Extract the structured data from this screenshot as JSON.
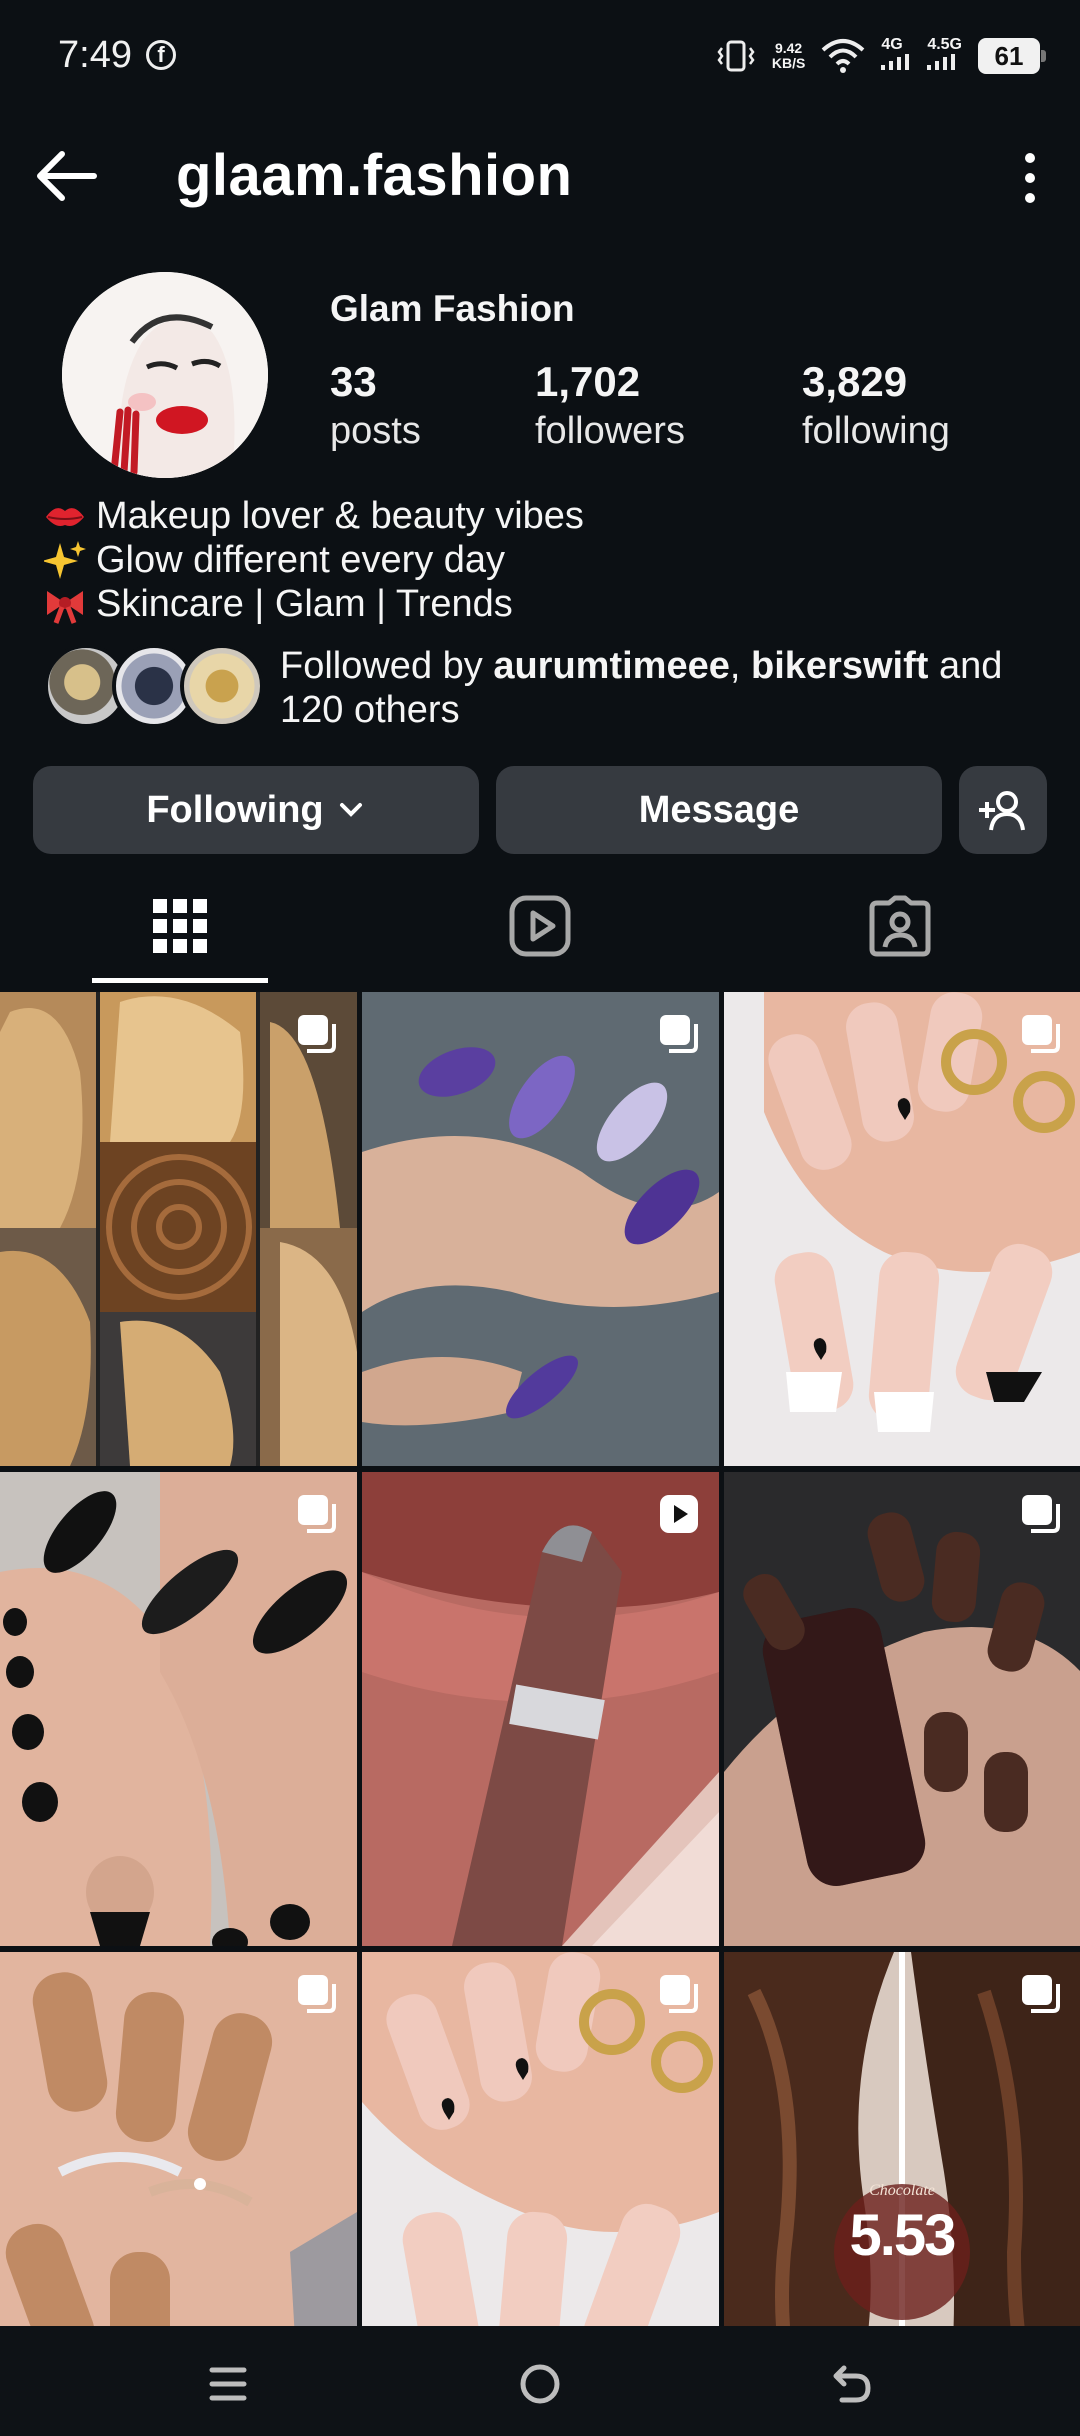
{
  "status_bar": {
    "time": "7:49",
    "speed_value": "9.42",
    "speed_unit": "KB/S",
    "net1": "4G",
    "net2": "4.5G",
    "battery": "61"
  },
  "header": {
    "username": "glaam.fashion"
  },
  "profile": {
    "display_name": "Glam Fashion",
    "stats": [
      {
        "value": "33",
        "label": "posts"
      },
      {
        "value": "1,702",
        "label": "followers"
      },
      {
        "value": "3,829",
        "label": "following"
      }
    ],
    "bio": [
      "Makeup lover & beauty vibes",
      "Glow different every day",
      "Skincare | Glam | Trends"
    ],
    "followed_by": {
      "prefix": "Followed by ",
      "user1": "aurumtimeee",
      "sep": ", ",
      "user2": "bikerswift",
      "suffix": " and 120 others"
    }
  },
  "actions": {
    "following_label": "Following",
    "message_label": "Message"
  },
  "tabs": [
    "grid-icon",
    "reels-icon",
    "tagged-icon"
  ],
  "grid": {
    "tiles": [
      {
        "subject": "hair collage",
        "badge": "carousel"
      },
      {
        "subject": "purple nails",
        "badge": "carousel"
      },
      {
        "subject": "french tip heart nails",
        "badge": "carousel"
      },
      {
        "subject": "black tip toes and nails",
        "badge": "carousel"
      },
      {
        "subject": "lip liner",
        "badge": "reel"
      },
      {
        "subject": "brown matte nails",
        "badge": "carousel"
      },
      {
        "subject": "nude nails with rings",
        "badge": "carousel"
      },
      {
        "subject": "french tip heart nails",
        "badge": "carousel"
      },
      {
        "subject": "chocolate hair",
        "badge": "carousel"
      }
    ],
    "hair_shade_name": "Chocolate",
    "hair_shade_code": "5.53"
  },
  "colors": {
    "background": "#0c1014",
    "button": "#363a40",
    "text": "#f5f5f5"
  }
}
